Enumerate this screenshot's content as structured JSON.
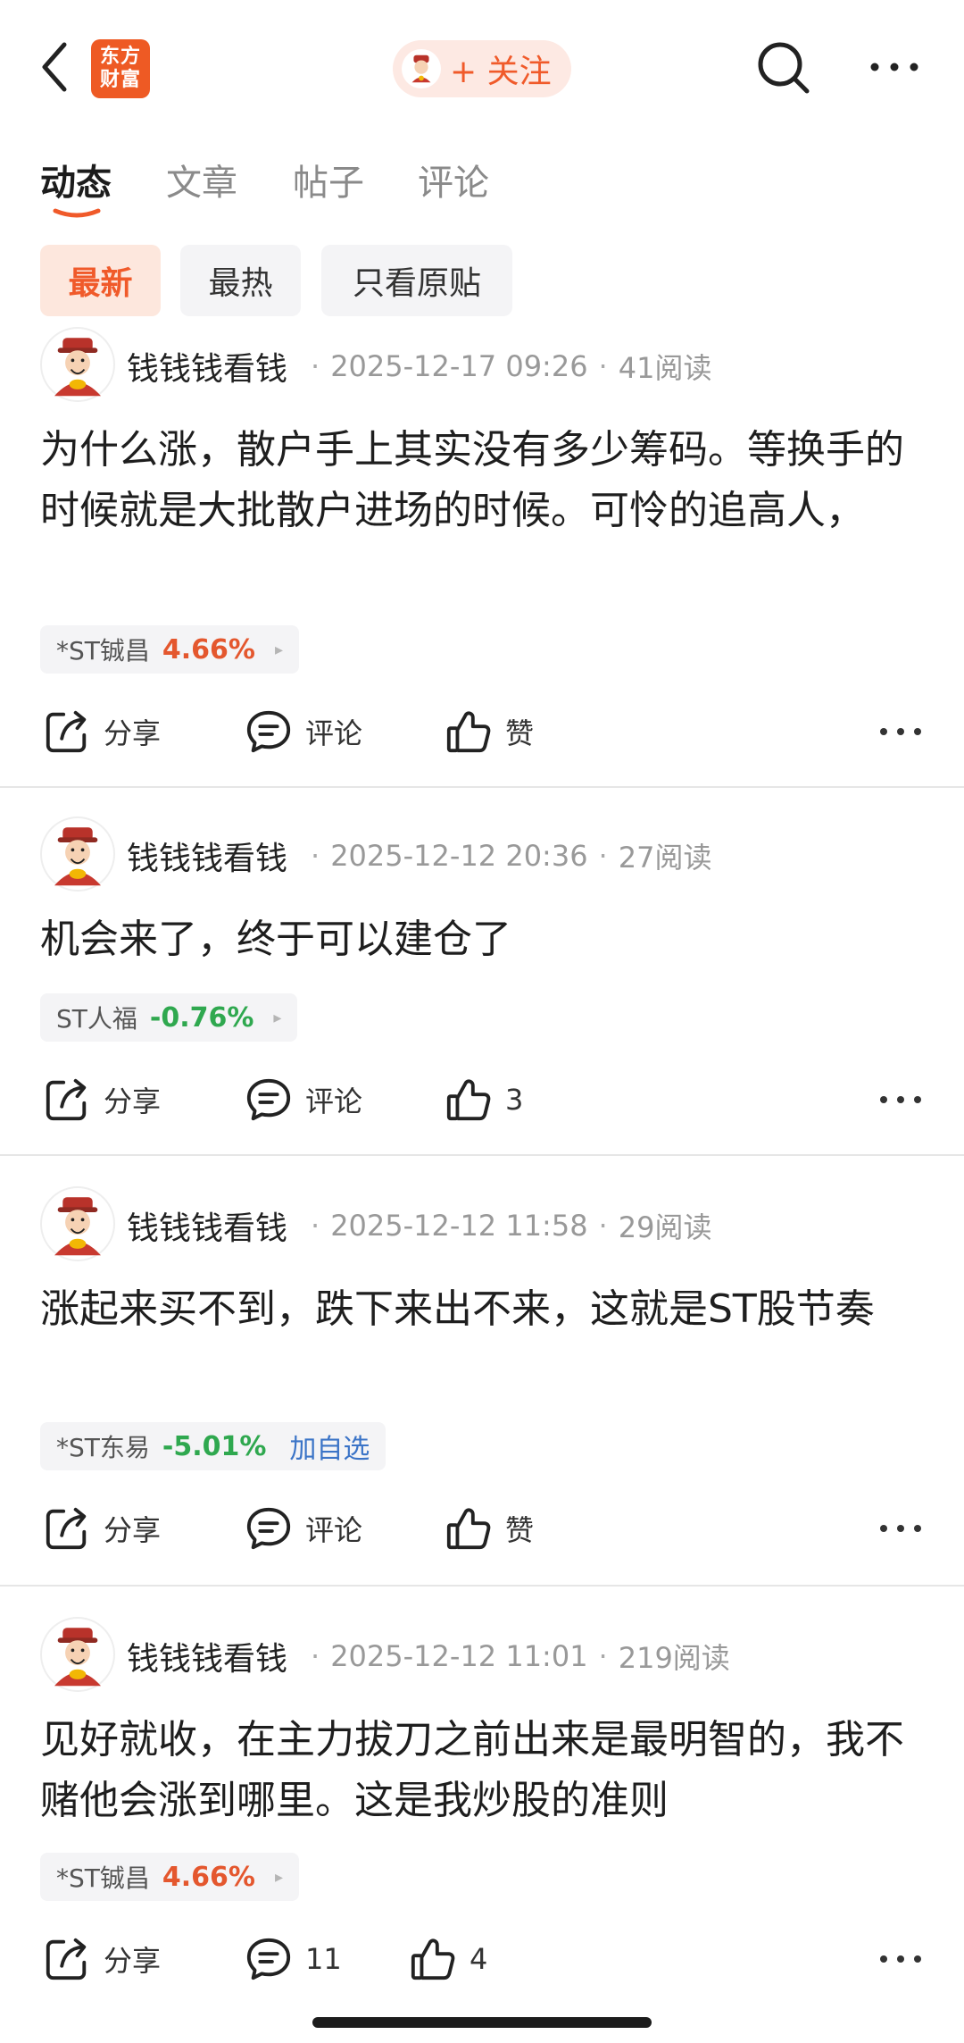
{
  "header": {
    "logo_line1": "东方",
    "logo_line2": "财富",
    "follow_label": "+ 关注",
    "colors": {
      "accent": "#f05a2a",
      "logo_bg": "#ee5a24"
    }
  },
  "tabs": [
    {
      "label": "动态",
      "active": true
    },
    {
      "label": "文章",
      "active": false
    },
    {
      "label": "帖子",
      "active": false
    },
    {
      "label": "评论",
      "active": false
    }
  ],
  "filters": [
    {
      "label": "最新",
      "active": true
    },
    {
      "label": "最热",
      "active": false
    },
    {
      "label": "只看原贴",
      "active": false
    }
  ],
  "posts": [
    {
      "author": "钱钱钱看钱",
      "time": "2025-12-17 09:26",
      "reads": "41阅读",
      "body": "为什么涨，散户手上其实没有多少筹码。等换手的时候就是大批散户进场的时候。可怜的追高人，",
      "stock": {
        "name": "*ST铖昌",
        "change": "4.66%",
        "direction": "up",
        "extra": "▸"
      },
      "share_label": "分享",
      "comment_label": "评论",
      "like_label": "赞"
    },
    {
      "author": "钱钱钱看钱",
      "time": "2025-12-12 20:36",
      "reads": "27阅读",
      "body": "机会来了，终于可以建仓了",
      "stock": {
        "name": "ST人福",
        "change": "-0.76%",
        "direction": "down",
        "extra": "▸"
      },
      "share_label": "分享",
      "comment_label": "评论",
      "like_label": "3"
    },
    {
      "author": "钱钱钱看钱",
      "time": "2025-12-12 11:58",
      "reads": "29阅读",
      "body": "涨起来买不到，跌下来出不来，这就是ST股节奏",
      "stock": {
        "name": "*ST东易",
        "change": "-5.01%",
        "direction": "down",
        "extra": "加自选"
      },
      "share_label": "分享",
      "comment_label": "评论",
      "like_label": "赞"
    },
    {
      "author": "钱钱钱看钱",
      "time": "2025-12-12 11:01",
      "reads": "219阅读",
      "body": "见好就收，在主力拔刀之前出来是最明智的，我不赌他会涨到哪里。这是我炒股的准则",
      "stock": {
        "name": "*ST铖昌",
        "change": "4.66%",
        "direction": "up",
        "extra": "▸"
      },
      "share_label": "分享",
      "comment_label": "11",
      "like_label": "4"
    }
  ]
}
